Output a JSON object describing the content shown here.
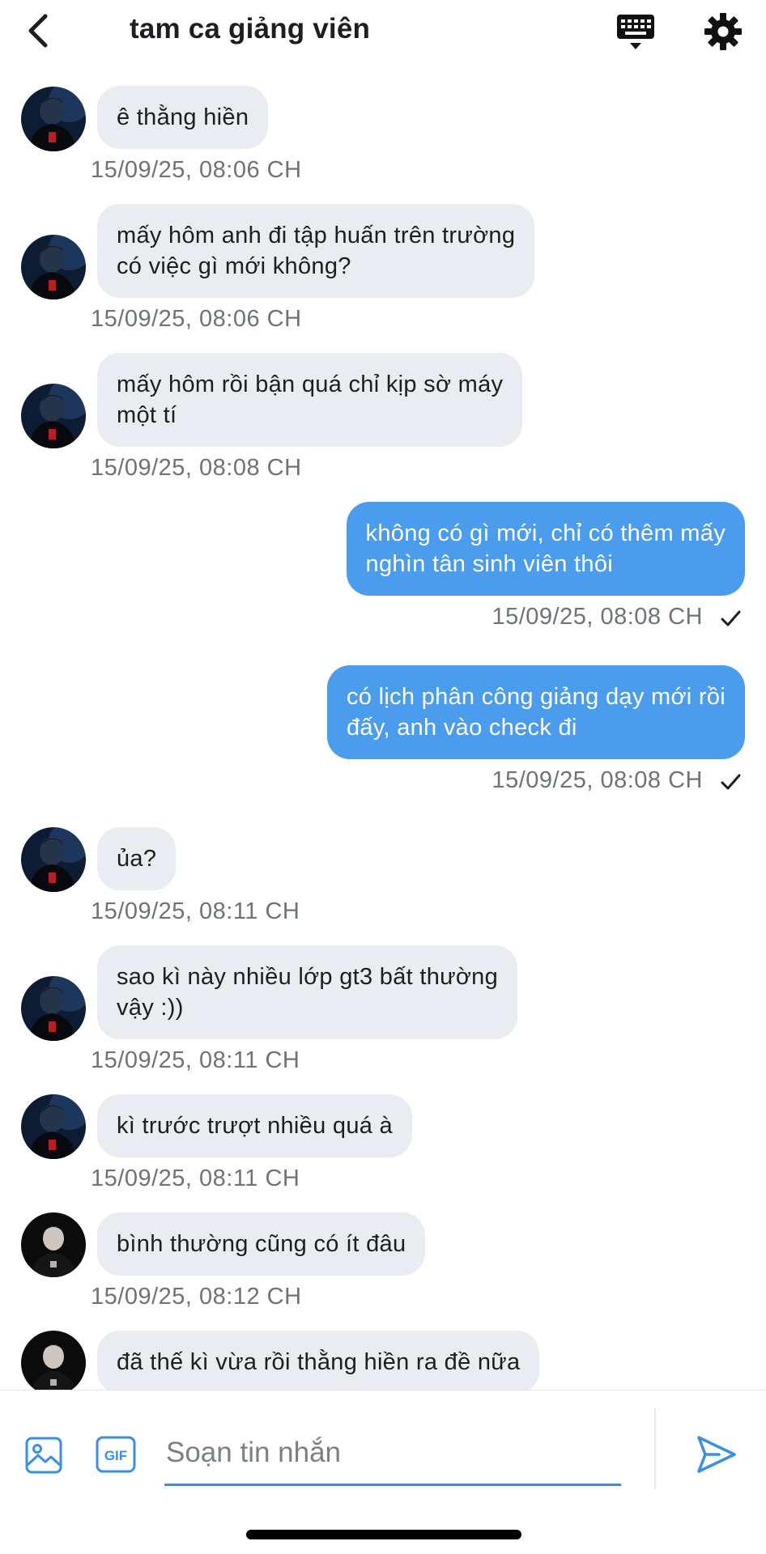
{
  "header": {
    "title": "tam ca giảng viên",
    "icons": {
      "back": "chevron-left-icon",
      "keyboard": "keyboard-icon",
      "settings": "gear-icon"
    }
  },
  "messages": [
    {
      "dir": "in",
      "avatar": "avatar-1",
      "text": "ê thằng hiền",
      "time": "15/09/25, 08:06 CH"
    },
    {
      "dir": "in",
      "avatar": "avatar-1",
      "text": "mấy hôm anh đi tập huấn trên trường\ncó việc gì mới không?",
      "time": "15/09/25, 08:06 CH"
    },
    {
      "dir": "in",
      "avatar": "avatar-1",
      "text": "mấy hôm rồi bận quá chỉ kịp sờ máy\nmột tí",
      "time": "15/09/25, 08:08 CH"
    },
    {
      "dir": "out",
      "text": "không có gì mới, chỉ có thêm mấy\nnghìn tân sinh viên thôi",
      "time": "15/09/25, 08:08 CH",
      "status": "sent-check-icon"
    },
    {
      "dir": "out",
      "text": "có lịch phân công giảng dạy mới rồi\nđấy, anh vào check đi",
      "time": "15/09/25, 08:08 CH",
      "status": "sent-check-icon"
    },
    {
      "dir": "in",
      "avatar": "avatar-1",
      "text": "ủa?",
      "time": "15/09/25, 08:11 CH"
    },
    {
      "dir": "in",
      "avatar": "avatar-1",
      "text": "sao kì này nhiều lớp gt3 bất thường\nvậy :))",
      "time": "15/09/25, 08:11 CH"
    },
    {
      "dir": "in",
      "avatar": "avatar-1",
      "text": "kì trước trượt nhiều quá à",
      "time": "15/09/25, 08:11 CH"
    },
    {
      "dir": "in",
      "avatar": "avatar-2",
      "text": "bình thường cũng có ít đâu",
      "time": "15/09/25, 08:12 CH"
    },
    {
      "dir": "in",
      "avatar": "avatar-2",
      "text": "đã thế kì vừa rồi thằng hiền ra đề nữa",
      "time": ""
    }
  ],
  "composer": {
    "placeholder": "Soạn tin nhắn",
    "gif_label": "GIF",
    "icons": {
      "image": "image-icon",
      "gif": "gif-icon",
      "send": "send-icon"
    }
  },
  "colors": {
    "incoming_bubble": "#e9ecf0",
    "outgoing_bubble": "#4b9cec",
    "accent": "#3a8fe0",
    "timestamp": "#6e7378"
  }
}
